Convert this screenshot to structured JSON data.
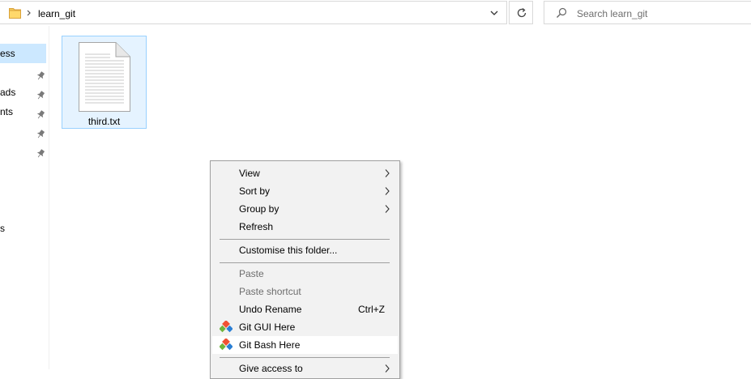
{
  "address_bar": {
    "path_segment": "learn_git",
    "folder_icon": "folder-icon",
    "separator_icon": "chevron-right-icon",
    "dropdown_icon": "chevron-down-icon",
    "refresh_icon": "refresh-icon"
  },
  "search": {
    "placeholder": "Search learn_git",
    "icon": "search-icon"
  },
  "nav_pane": {
    "items": [
      {
        "label": "ess",
        "selected": true,
        "pinned": false
      },
      {
        "label": "",
        "pinned": true
      },
      {
        "label": "ads",
        "pinned": true
      },
      {
        "label": "nts",
        "pinned": true
      },
      {
        "label": "",
        "pinned": true
      },
      {
        "label": "",
        "pinned": true
      },
      {
        "label": "s",
        "pinned": false
      }
    ]
  },
  "files": [
    {
      "name": "third.txt",
      "icon": "text-file-icon",
      "selected": true
    }
  ],
  "context_menu": {
    "items": [
      {
        "label": "View",
        "submenu": true
      },
      {
        "label": "Sort by",
        "submenu": true
      },
      {
        "label": "Group by",
        "submenu": true
      },
      {
        "label": "Refresh"
      },
      {
        "label": "Customise this folder..."
      },
      {
        "label": "Paste",
        "disabled": true
      },
      {
        "label": "Paste shortcut",
        "disabled": true
      },
      {
        "label": "Undo Rename",
        "shortcut": "Ctrl+Z"
      },
      {
        "label": "Git GUI Here",
        "icon": "git-icon"
      },
      {
        "label": "Git Bash Here",
        "icon": "git-icon",
        "highlighted": true
      },
      {
        "label": "Give access to",
        "submenu": true
      }
    ]
  },
  "colors": {
    "selection_bg": "#cce8ff",
    "tile_bg": "#e5f3ff",
    "tile_border": "#99d1ff",
    "menu_bg": "#f2f2f2",
    "git_orange": "#f05133",
    "git_green": "#70b43c",
    "git_blue": "#2a7fd4"
  }
}
